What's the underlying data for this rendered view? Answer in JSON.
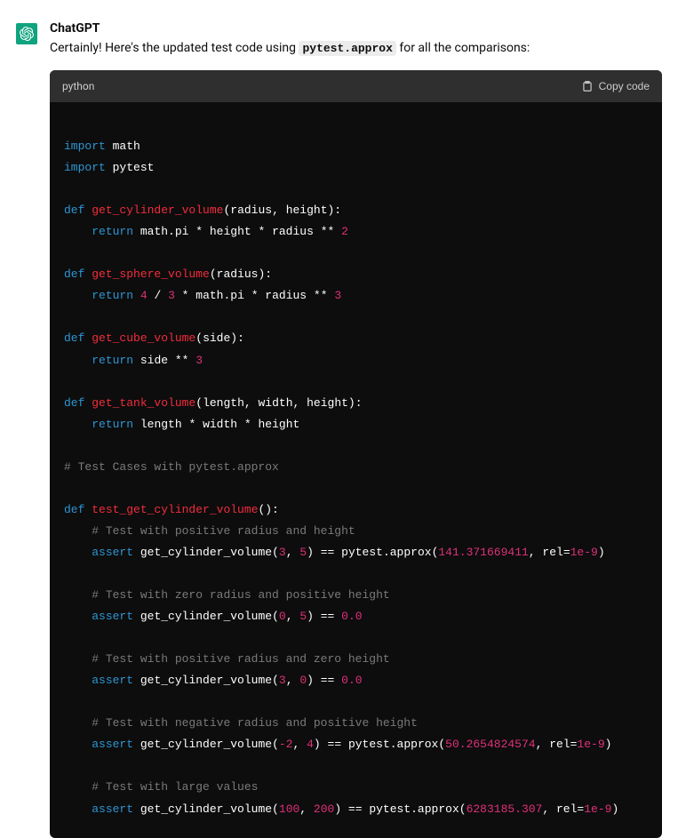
{
  "author": "ChatGPT",
  "reply": {
    "pre": "Certainly! Here's the updated test code using ",
    "code_inline": "pytest.approx",
    "post": " for all the comparisons:"
  },
  "code": {
    "language": "python",
    "copy_label": "Copy code",
    "tokens": {
      "import": "import",
      "def": "def",
      "return": "return",
      "assert": "assert",
      "math": "math",
      "pytest": "pytest",
      "fn_cyl": "get_cylinder_volume",
      "fn_sph": "get_sphere_volume",
      "fn_cube": "get_cube_volume",
      "fn_tank": "get_tank_volume",
      "fn_test_cyl": "test_get_cylinder_volume",
      "p_radius": "radius",
      "p_height": "height",
      "p_side": "side",
      "p_length": "length",
      "p_width": "width",
      "mathpi": "math.pi",
      "approx": "pytest.approx",
      "rel": "rel",
      "n2": "2",
      "n3": "3",
      "n4": "4",
      "n5": "5",
      "n0": "0",
      "nneg2": "-2",
      "n100": "100",
      "n200": "200",
      "v0": "0.0",
      "v_cyl1": "141.371669411",
      "v_cyl2": "50.2654824574",
      "v_cyl3": "6283185.307",
      "rel_val": "1e-9",
      "c_block": "# Test Cases with pytest.approx",
      "c1": "# Test with positive radius and height",
      "c2": "# Test with zero radius and positive height",
      "c3": "# Test with positive radius and zero height",
      "c4": "# Test with negative radius and positive height",
      "c5": "# Test with large values"
    }
  }
}
